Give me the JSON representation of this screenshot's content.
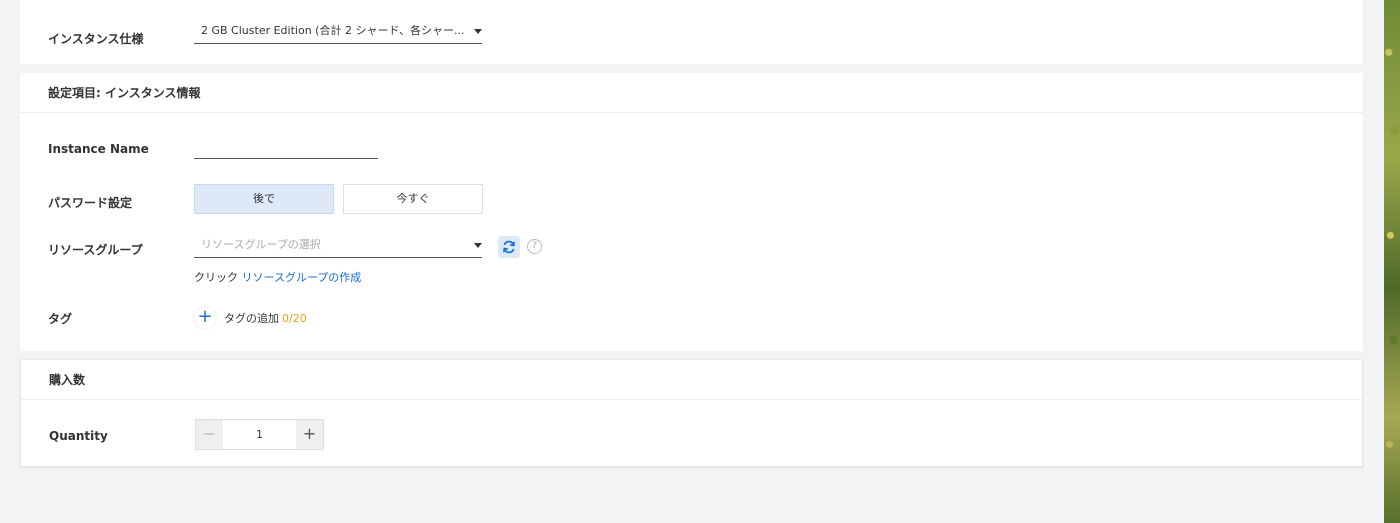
{
  "top": {
    "spec_label": "インスタンス仕様",
    "spec_value": "2 GB Cluster Edition (合計 2 シャード、各シャー..."
  },
  "info": {
    "section_title": "設定項目: インスタンス情報",
    "instance_name_label": "Instance Name",
    "instance_name_value": "",
    "password_label": "パスワード設定",
    "password_options": [
      "後で",
      "今すぐ"
    ],
    "password_selected": "後で",
    "resource_group_label": "リソースグループ",
    "resource_group_placeholder": "リソースグループの選択",
    "hint_prefix": "クリック",
    "hint_link": "リソースグループの作成",
    "tag_label": "タグ",
    "tag_add_label": "タグの追加",
    "tag_count": "0/20"
  },
  "purchase": {
    "section_title": "購入数",
    "quantity_label": "Quantity",
    "quantity_value": "1",
    "minus": "−",
    "plus": "+"
  },
  "colors": {
    "accent": "#1a6fd0",
    "count": "#f0a020",
    "selected_bg": "#dde9f7"
  }
}
